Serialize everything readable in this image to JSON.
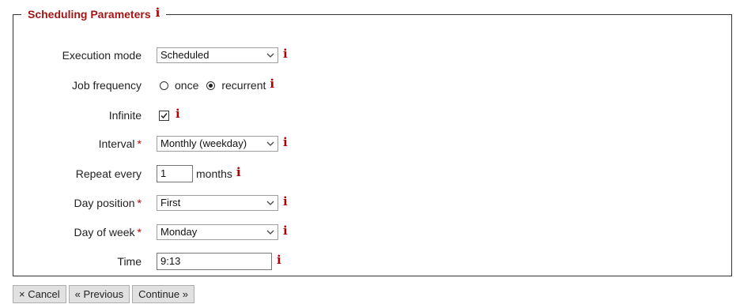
{
  "section": {
    "title": "Scheduling Parameters",
    "info_glyph": "i"
  },
  "fields": {
    "execution_mode": {
      "label": "Execution mode",
      "value": "Scheduled"
    },
    "job_frequency": {
      "label": "Job frequency",
      "options": [
        "once",
        "recurrent"
      ],
      "selected": "recurrent"
    },
    "infinite": {
      "label": "Infinite",
      "checked": true
    },
    "interval": {
      "label": "Interval",
      "required_mark": "*",
      "value": "Monthly (weekday)"
    },
    "repeat_every": {
      "label": "Repeat every",
      "value": "1",
      "unit": "months"
    },
    "day_position": {
      "label": "Day position",
      "required_mark": "*",
      "value": "First"
    },
    "day_of_week": {
      "label": "Day of week",
      "required_mark": "*",
      "value": "Monday"
    },
    "time": {
      "label": "Time",
      "value": "9:13"
    }
  },
  "buttons": {
    "cancel": "× Cancel",
    "previous": "« Previous",
    "continue": "Continue »"
  },
  "colors": {
    "accent": "#a31515",
    "required": "#c00000",
    "button_bg": "#e1e1e1"
  },
  "icons": {
    "info": "info-icon",
    "dropdown": "chevron-down-icon",
    "checkbox": "checkmark-icon"
  }
}
